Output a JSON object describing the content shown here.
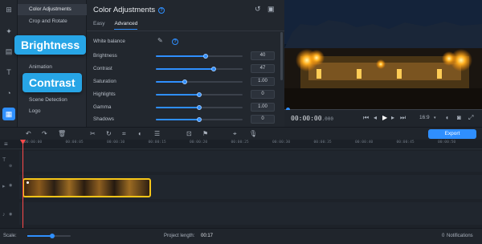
{
  "rail": {
    "icons": [
      "import-icon",
      "wand-icon",
      "filters-icon",
      "titles-icon",
      "stickers-icon",
      "more-tools-icon"
    ]
  },
  "categories": [
    {
      "label": "Color Adjustments",
      "selected": true
    },
    {
      "label": "Crop and Rotate",
      "selected": false
    },
    {
      "label": "Animation",
      "selected": false
    },
    {
      "label": "Scene Detection",
      "selected": false
    },
    {
      "label": "Logo",
      "selected": false
    }
  ],
  "panel": {
    "title": "Color Adjustments",
    "help": "?",
    "tabs": [
      {
        "label": "Easy",
        "active": false
      },
      {
        "label": "Advanced",
        "active": true
      }
    ],
    "white_balance_label": "White balance",
    "sliders": [
      {
        "label": "Brightness",
        "value": "40",
        "fraction": 0.57
      },
      {
        "label": "Contrast",
        "value": "47",
        "fraction": 0.67
      },
      {
        "label": "Saturation",
        "value": "1.00",
        "fraction": 0.33
      },
      {
        "label": "Highlights",
        "value": "0",
        "fraction": 0.5
      },
      {
        "label": "Gamma",
        "value": "1.00",
        "fraction": 0.5
      },
      {
        "label": "Shadows",
        "value": "0",
        "fraction": 0.5
      }
    ]
  },
  "callouts": {
    "brightness": "Brightness",
    "contrast": "Contrast"
  },
  "player": {
    "timecode": "00:00:00",
    "timecode_ms": ".000",
    "aspect": "16:9"
  },
  "toolbar": {
    "export_label": "Export"
  },
  "ruler": {
    "ticks": [
      "00:00:00",
      "00:00:05",
      "00:00:10",
      "00:00:15",
      "00:00:20",
      "00:00:25",
      "00:00:30",
      "00:00:35",
      "00:00:40",
      "00:00:45",
      "00:00:50"
    ]
  },
  "status": {
    "scale_label": "Scale:",
    "project_length_label": "Project length:",
    "project_length": "00:17",
    "notifications_count": "0",
    "notifications_label": "Notifications"
  },
  "colors": {
    "accent": "#2f8ffe",
    "callout": "#27a5e6",
    "clip_border": "#f5c518",
    "playhead": "#ff4a4a"
  }
}
